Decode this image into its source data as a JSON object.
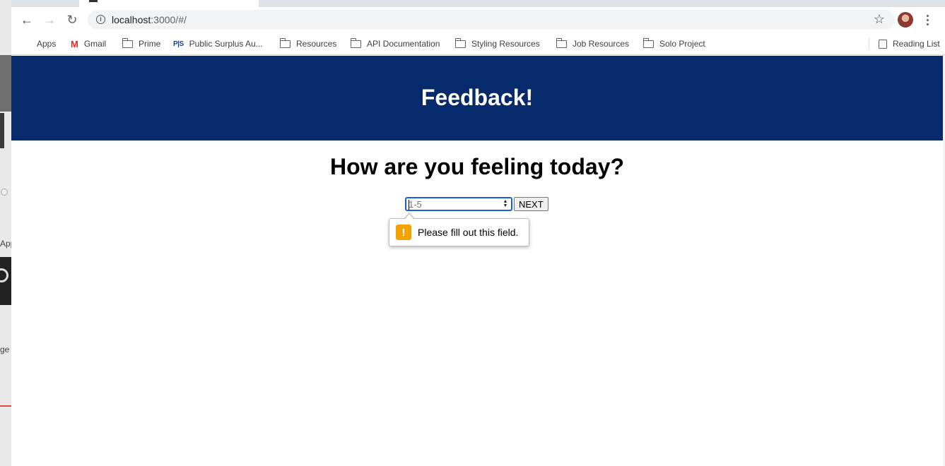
{
  "browser": {
    "url_host": "localhost",
    "url_path": ":3000/#/",
    "bookmarks": [
      {
        "label": "Apps",
        "icon": "apps-grid-icon"
      },
      {
        "label": "Gmail",
        "icon": "gmail-icon"
      },
      {
        "label": "Prime",
        "icon": "folder-icon"
      },
      {
        "label": "Public Surplus Au...",
        "icon": "public-surplus-icon"
      },
      {
        "label": "Resources",
        "icon": "folder-icon"
      },
      {
        "label": "API Documentation",
        "icon": "folder-icon"
      },
      {
        "label": "Styling Resources",
        "icon": "folder-icon"
      },
      {
        "label": "Job Resources",
        "icon": "folder-icon"
      },
      {
        "label": "Solo Project",
        "icon": "folder-icon"
      }
    ],
    "reading_list": "Reading List"
  },
  "page": {
    "header_title": "Feedback!",
    "question": "How are you feeling today?",
    "input_placeholder": "1-5",
    "next_button": "NEXT",
    "validation_message": "Please fill out this field.",
    "accent_color": "#062a6b"
  }
}
